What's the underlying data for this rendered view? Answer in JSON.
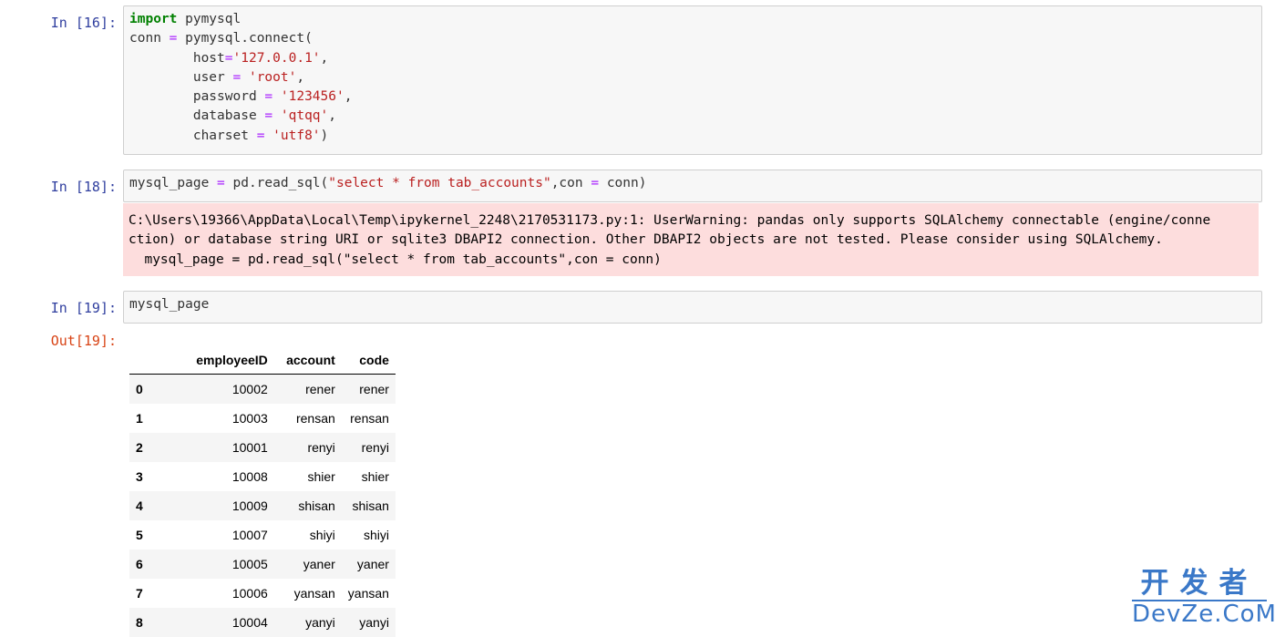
{
  "cells": [
    {
      "prompt": "In  [16]:",
      "lines": [
        [
          {
            "t": "import",
            "c": "kw"
          },
          {
            "t": " pymysql",
            "c": ""
          }
        ],
        [
          {
            "t": "conn ",
            "c": ""
          },
          {
            "t": "=",
            "c": "op"
          },
          {
            "t": " pymysql.connect(",
            "c": ""
          }
        ],
        [
          {
            "t": "        host",
            "c": ""
          },
          {
            "t": "=",
            "c": "op"
          },
          {
            "t": "'127.0.0.1'",
            "c": "str"
          },
          {
            "t": ",",
            "c": ""
          }
        ],
        [
          {
            "t": "        user ",
            "c": ""
          },
          {
            "t": "=",
            "c": "op"
          },
          {
            "t": " ",
            "c": ""
          },
          {
            "t": "'root'",
            "c": "str"
          },
          {
            "t": ",",
            "c": ""
          }
        ],
        [
          {
            "t": "        password ",
            "c": ""
          },
          {
            "t": "=",
            "c": "op"
          },
          {
            "t": " ",
            "c": ""
          },
          {
            "t": "'123456'",
            "c": "str"
          },
          {
            "t": ",",
            "c": ""
          }
        ],
        [
          {
            "t": "        database ",
            "c": ""
          },
          {
            "t": "=",
            "c": "op"
          },
          {
            "t": " ",
            "c": ""
          },
          {
            "t": "'qtqq'",
            "c": "str"
          },
          {
            "t": ",",
            "c": ""
          }
        ],
        [
          {
            "t": "        charset ",
            "c": ""
          },
          {
            "t": "=",
            "c": "op"
          },
          {
            "t": " ",
            "c": ""
          },
          {
            "t": "'utf8'",
            "c": "str"
          },
          {
            "t": ")",
            "c": ""
          }
        ]
      ]
    },
    {
      "prompt": "In  [18]:",
      "lines": [
        [
          {
            "t": "mysql_page ",
            "c": ""
          },
          {
            "t": "=",
            "c": "op"
          },
          {
            "t": " pd.read_sql(",
            "c": ""
          },
          {
            "t": "\"select * from tab_accounts\"",
            "c": "str"
          },
          {
            "t": ",con ",
            "c": ""
          },
          {
            "t": "=",
            "c": "op"
          },
          {
            "t": " conn)",
            "c": ""
          }
        ]
      ]
    },
    {
      "prompt": "In  [19]:",
      "lines": [
        [
          {
            "t": "mysql_page",
            "c": ""
          }
        ]
      ]
    }
  ],
  "warning_lines": [
    "C:\\Users\\19366\\AppData\\Local\\Temp\\ipykernel_2248\\2170531173.py:1: UserWarning: pandas only supports SQLAlchemy connectable (engine/conne",
    "ction) or database string URI or sqlite3 DBAPI2 connection. Other DBAPI2 objects are not tested. Please consider using SQLAlchemy.",
    "  mysql_page = pd.read_sql(\"select * from tab_accounts\",con = conn)"
  ],
  "output": {
    "prompt": "Out[19]:",
    "columns": [
      "",
      "employeeID",
      "account",
      "code"
    ],
    "rows": [
      [
        "0",
        "10002",
        "rener",
        "rener"
      ],
      [
        "1",
        "10003",
        "rensan",
        "rensan"
      ],
      [
        "2",
        "10001",
        "renyi",
        "renyi"
      ],
      [
        "3",
        "10008",
        "shier",
        "shier"
      ],
      [
        "4",
        "10009",
        "shisan",
        "shisan"
      ],
      [
        "5",
        "10007",
        "shiyi",
        "shiyi"
      ],
      [
        "6",
        "10005",
        "yaner",
        "yaner"
      ],
      [
        "7",
        "10006",
        "yansan",
        "yansan"
      ],
      [
        "8",
        "10004",
        "yanyi",
        "yanyi"
      ]
    ]
  },
  "watermark": {
    "top": "开发者",
    "bottom": "DevZe.CoM"
  },
  "colors": {
    "prompt_in": "#303f9f",
    "prompt_out": "#d84315",
    "keyword": "#008000",
    "operator": "#aa22ff",
    "string": "#ba2121",
    "stderr_bg": "#fddddd",
    "watermark": "#3a78c8"
  }
}
